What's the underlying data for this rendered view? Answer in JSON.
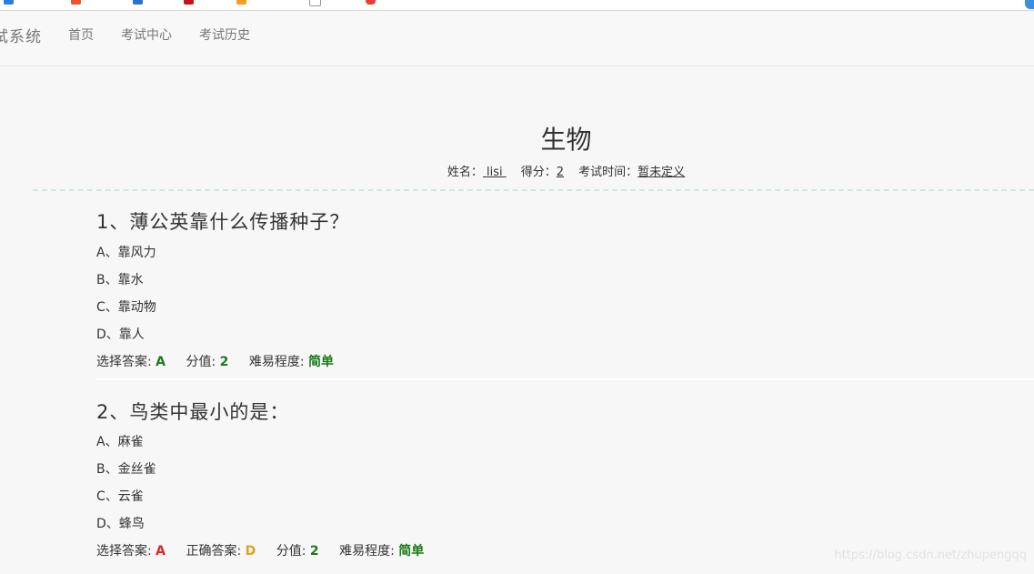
{
  "colors": {
    "background": "#f7f7f7",
    "navbar_bg": "#f8f8f8",
    "nav_text": "#777777",
    "correct_green": "#1a7a1a",
    "wrong_red": "#e02020",
    "answer_orange": "#e0a020",
    "divider": "#cfe6e6"
  },
  "navbar": {
    "brand": "试系统",
    "links": [
      "首页",
      "考试中心",
      "考试历史"
    ]
  },
  "paper": {
    "title": "生物",
    "name_label": "姓名：",
    "name_value": " lisi ",
    "score_label": "得分：",
    "score_value": "2",
    "time_label": "考试时间：",
    "time_value": "暂未定义"
  },
  "questions": [
    {
      "title": "1、薄公英靠什么传播种子？",
      "options": [
        "A、靠风力",
        "B、靠水",
        "C、靠动物",
        "D、靠人"
      ],
      "selected_label": "选择答案:",
      "selected_value": "A",
      "score_label": "分值:",
      "score_value": "2",
      "difficulty_label": "难易程度:",
      "difficulty_value": "简单"
    },
    {
      "title": "2、鸟类中最小的是：",
      "options": [
        "A、麻雀",
        "B、金丝雀",
        "C、云雀",
        "D、蜂鸟"
      ],
      "selected_label": "选择答案:",
      "selected_value": "A",
      "correct_label": "正确答案:",
      "correct_value": "D",
      "score_label": "分值:",
      "score_value": "2",
      "difficulty_label": "难易程度:",
      "difficulty_value": "简单"
    }
  ],
  "watermark": "https://blog.csdn.net/zhupengqq"
}
